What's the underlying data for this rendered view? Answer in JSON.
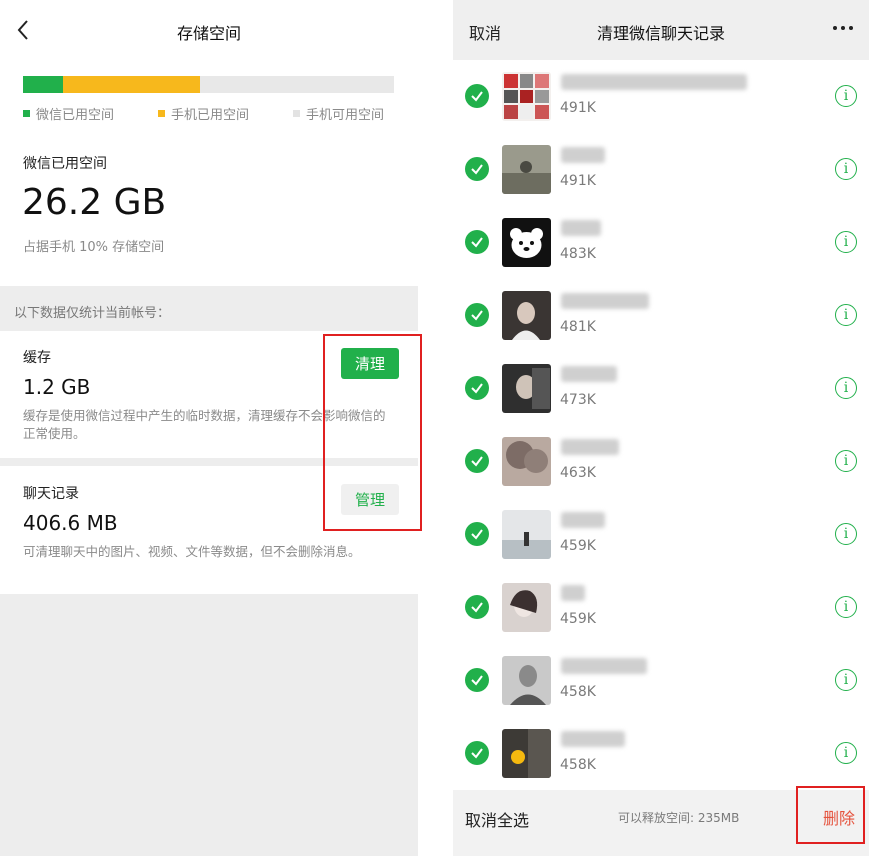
{
  "left": {
    "nav_title": "存储空间",
    "legend": {
      "wechat_used": "微信已用空间",
      "phone_used": "手机已用空间",
      "phone_free": "手机可用空间"
    },
    "colors": {
      "wechat": "#21b04b",
      "phone": "#f7b81c",
      "free": "#e8e8e8",
      "highlight": "#e02020"
    },
    "usage_bar": {
      "wechat_fraction": 0.108,
      "phone_fraction": 0.369
    },
    "wechat_used_label": "微信已用空间",
    "wechat_used_value": "26.2 GB",
    "wechat_used_sub": "占据手机 10% 存储空间",
    "section_hint": "以下数据仅统计当前帐号：",
    "cache": {
      "title": "缓存",
      "value": "1.2 GB",
      "button": "清理",
      "desc": "缓存是使用微信过程中产生的临时数据，清理缓存不会影响微信的正常使用。"
    },
    "chat": {
      "title": "聊天记录",
      "value": "406.6 MB",
      "button": "管理",
      "desc": "可清理聊天中的图片、视频、文件等数据，但不会删除消息。"
    }
  },
  "right": {
    "cancel": "取消",
    "title": "清理微信聊天记录",
    "rows": [
      {
        "size": "491K",
        "avatar": "collage"
      },
      {
        "size": "491K",
        "avatar": "landscape"
      },
      {
        "size": "483K",
        "avatar": "bear"
      },
      {
        "size": "481K",
        "avatar": "portrait-dark"
      },
      {
        "size": "473K",
        "avatar": "portrait-car"
      },
      {
        "size": "463K",
        "avatar": "tree"
      },
      {
        "size": "459K",
        "avatar": "sea"
      },
      {
        "size": "459K",
        "avatar": "portrait-light"
      },
      {
        "size": "458K",
        "avatar": "portrait-mono"
      },
      {
        "size": "458K",
        "avatar": "dark-room"
      }
    ],
    "footer": {
      "deselect_all": "取消全选",
      "freeable": "可以释放空间: 235MB",
      "delete": "删除"
    }
  }
}
